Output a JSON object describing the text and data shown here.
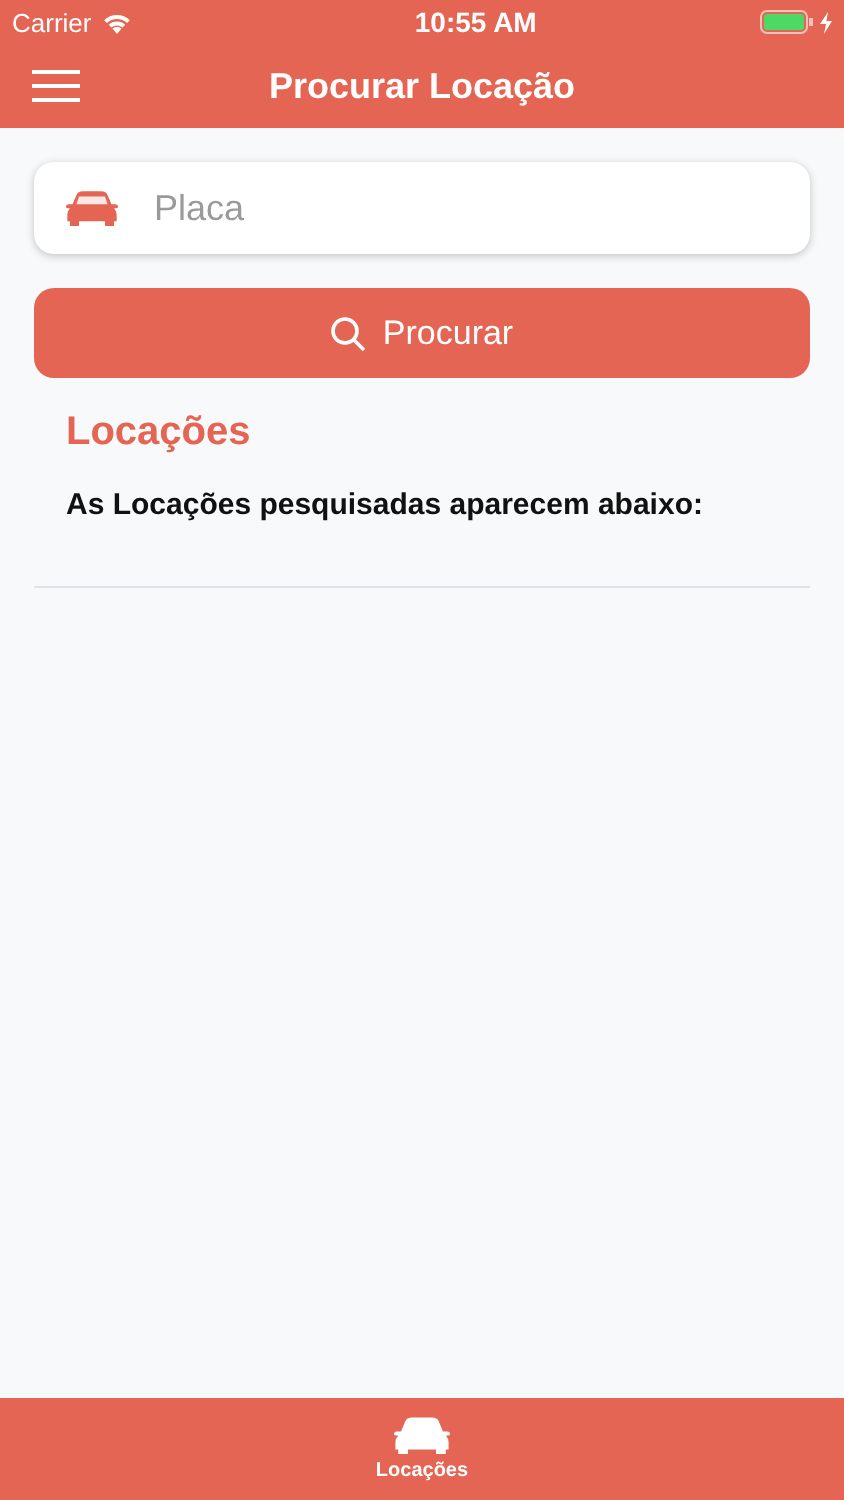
{
  "status_bar": {
    "carrier": "Carrier",
    "time": "10:55 AM"
  },
  "nav_bar": {
    "title": "Procurar Locação"
  },
  "search_field": {
    "placeholder": "Placa"
  },
  "search_button": {
    "label": "Procurar"
  },
  "section": {
    "title": "Locações",
    "subtitle": "As Locações pesquisadas aparecem abaixo:"
  },
  "tab_bar": [
    {
      "label": "Locações",
      "selected": true
    }
  ]
}
